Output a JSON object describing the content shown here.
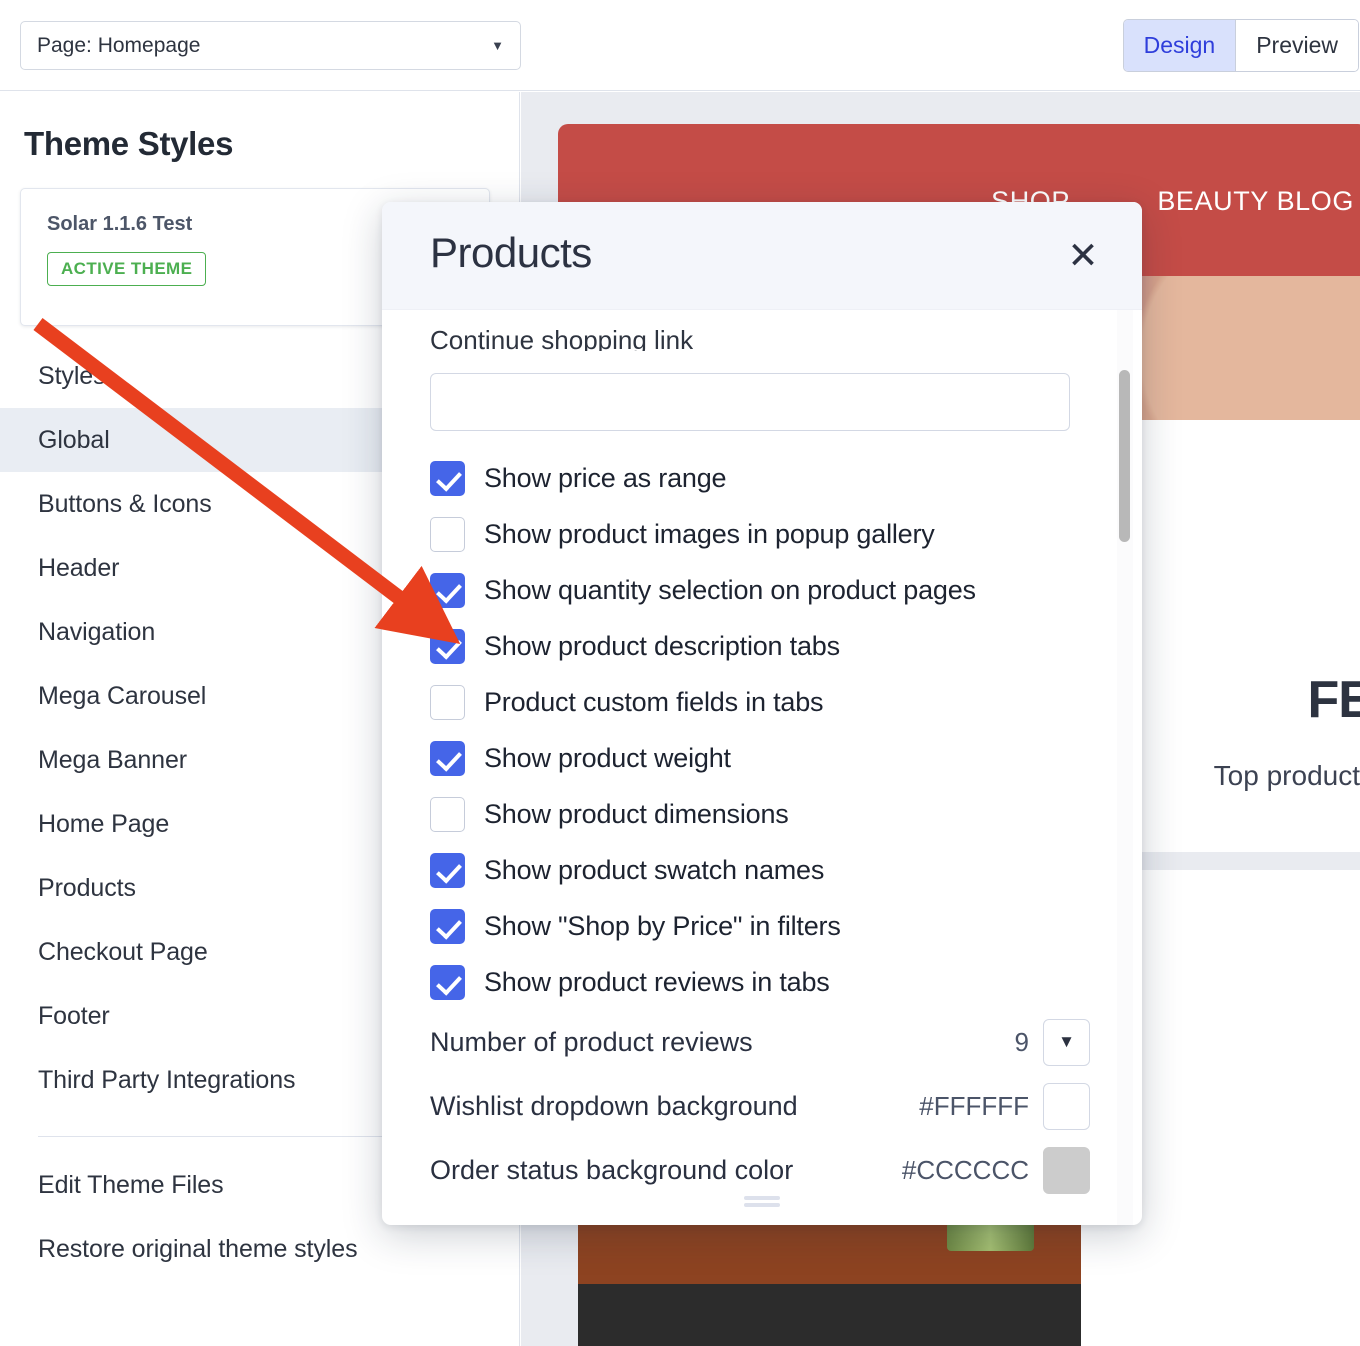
{
  "topbar": {
    "page_selector_label": "Page: Homepage",
    "caret_icon": "chevron-down-icon",
    "segmented": [
      {
        "label": "Design",
        "active": true
      },
      {
        "label": "Preview",
        "active": false
      }
    ]
  },
  "sidebar": {
    "title": "Theme Styles",
    "theme_card": {
      "name": "Solar 1.1.6 Test",
      "badge": "ACTIVE THEME",
      "badge_color": "#4caf50"
    },
    "items": [
      {
        "label": "Styles",
        "selected": false
      },
      {
        "label": "Global",
        "selected": true
      },
      {
        "label": "Buttons & Icons",
        "selected": false
      },
      {
        "label": "Header",
        "selected": false
      },
      {
        "label": "Navigation",
        "selected": false
      },
      {
        "label": "Mega Carousel",
        "selected": false
      },
      {
        "label": "Mega Banner",
        "selected": false
      },
      {
        "label": "Home Page",
        "selected": false
      },
      {
        "label": "Products",
        "selected": false
      },
      {
        "label": "Checkout Page",
        "selected": false
      },
      {
        "label": "Footer",
        "selected": false
      },
      {
        "label": "Third Party Integrations",
        "selected": false
      }
    ],
    "footer_links": [
      {
        "label": "Edit Theme Files"
      },
      {
        "label": "Restore original theme styles"
      }
    ]
  },
  "preview": {
    "header_bg": "#c44c47",
    "nav": [
      {
        "label": "SHOP",
        "has_caret": true
      },
      {
        "label": "BEAUTY BLOG",
        "has_caret": false
      }
    ],
    "featured_title": "FE",
    "featured_subtitle": "Top products"
  },
  "modal": {
    "title": "Products",
    "close_icon": "close-icon",
    "continue_shopping": {
      "label": "Continue shopping link",
      "value": "",
      "placeholder": ""
    },
    "checkboxes": [
      {
        "label": "Show price as range",
        "checked": true
      },
      {
        "label": "Show product images in popup gallery",
        "checked": false
      },
      {
        "label": "Show quantity selection on product pages",
        "checked": true
      },
      {
        "label": "Show product description tabs",
        "checked": true
      },
      {
        "label": "Product custom fields in tabs",
        "checked": false
      },
      {
        "label": "Show product weight",
        "checked": true
      },
      {
        "label": "Show product dimensions",
        "checked": false
      },
      {
        "label": "Show product swatch names",
        "checked": true
      },
      {
        "label": "Show \"Shop by Price\" in filters",
        "checked": true
      },
      {
        "label": "Show product reviews in tabs",
        "checked": true
      }
    ],
    "value_rows": [
      {
        "label": "Number of product reviews",
        "value": "9",
        "control": "dropdown",
        "swatch": ""
      },
      {
        "label": "Wishlist dropdown background",
        "value": "#FFFFFF",
        "control": "swatch",
        "swatch": "#FFFFFF"
      },
      {
        "label": "Order status background color",
        "value": "#CCCCCC",
        "control": "swatch",
        "swatch": "#CCCCCC"
      }
    ],
    "checkbox_accent": "#4565e8"
  },
  "annotation": {
    "arrow_color": "#e8401f",
    "arrow_from": "theme-card-bottom-left",
    "arrow_to": "show-product-description-tabs-checkbox"
  }
}
